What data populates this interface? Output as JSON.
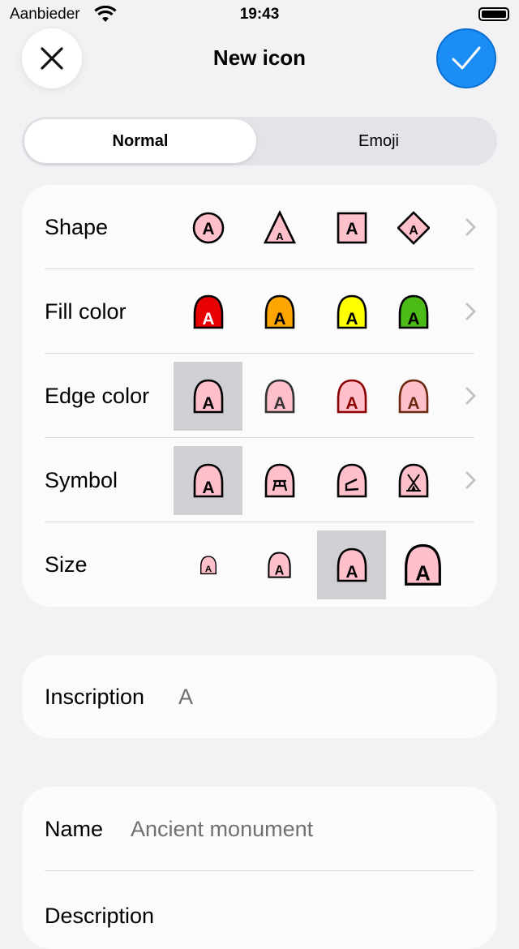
{
  "status_bar": {
    "carrier": "Aanbieder",
    "time": "19:43"
  },
  "header": {
    "title": "New icon"
  },
  "segmented": {
    "options": [
      "Normal",
      "Emoji"
    ],
    "selected": "Normal"
  },
  "options_card": {
    "rows": [
      {
        "label": "Shape",
        "chevron": true,
        "items": [
          {
            "shape": "circle",
            "fill": "#ffc0cb",
            "edge": "#000000",
            "symbol": "A",
            "scale": 1
          },
          {
            "shape": "triangle",
            "fill": "#ffc0cb",
            "edge": "#000000",
            "symbol": "A",
            "scale": 1
          },
          {
            "shape": "square",
            "fill": "#ffc0cb",
            "edge": "#000000",
            "symbol": "A",
            "scale": 1
          },
          {
            "shape": "diamond",
            "fill": "#ffc0cb",
            "edge": "#000000",
            "symbol": "A",
            "scale": 1
          }
        ]
      },
      {
        "label": "Fill color",
        "chevron": true,
        "items": [
          {
            "shape": "arch",
            "fill": "#e60000",
            "edge": "#000000",
            "symbol": "A",
            "text": "#ffffff",
            "scale": 1
          },
          {
            "shape": "arch",
            "fill": "#ffa500",
            "edge": "#000000",
            "symbol": "A",
            "scale": 1
          },
          {
            "shape": "arch",
            "fill": "#ffff00",
            "edge": "#000000",
            "symbol": "A",
            "scale": 1
          },
          {
            "shape": "arch",
            "fill": "#4cbb17",
            "edge": "#000000",
            "symbol": "A",
            "scale": 1
          }
        ]
      },
      {
        "label": "Edge color",
        "chevron": true,
        "selected": 0,
        "items": [
          {
            "shape": "arch",
            "fill": "#ffc0cb",
            "edge": "#000000",
            "symbol": "A",
            "scale": 1
          },
          {
            "shape": "arch",
            "fill": "#ffc0cb",
            "edge": "#333333",
            "symbol": "A",
            "text": "#333333",
            "scale": 1
          },
          {
            "shape": "arch",
            "fill": "#ffc0cb",
            "edge": "#8b0000",
            "symbol": "A",
            "text": "#8b0000",
            "scale": 1
          },
          {
            "shape": "arch",
            "fill": "#ffc0cb",
            "edge": "#6b2a10",
            "symbol": "A",
            "text": "#6b2a10",
            "scale": 1
          }
        ]
      },
      {
        "label": "Symbol",
        "chevron": true,
        "selected": 0,
        "items": [
          {
            "shape": "arch",
            "fill": "#ffc0cb",
            "edge": "#000000",
            "symbol": "A",
            "scale": 1
          },
          {
            "shape": "arch",
            "fill": "#ffc0cb",
            "edge": "#000000",
            "symbol": "picnic-table",
            "scale": 1
          },
          {
            "shape": "arch",
            "fill": "#ffc0cb",
            "edge": "#000000",
            "symbol": "ramp",
            "scale": 1
          },
          {
            "shape": "arch",
            "fill": "#ffc0cb",
            "edge": "#000000",
            "symbol": "tent",
            "scale": 1
          }
        ]
      },
      {
        "label": "Size",
        "chevron": false,
        "selected": 2,
        "items": [
          {
            "shape": "arch",
            "fill": "#ffc0cb",
            "edge": "#000000",
            "symbol": "A",
            "scale": 0.55
          },
          {
            "shape": "arch",
            "fill": "#ffc0cb",
            "edge": "#000000",
            "symbol": "A",
            "scale": 0.78
          },
          {
            "shape": "arch",
            "fill": "#ffc0cb",
            "edge": "#000000",
            "symbol": "A",
            "scale": 1
          },
          {
            "shape": "arch",
            "fill": "#ffc0cb",
            "edge": "#000000",
            "symbol": "A",
            "scale": 1.22
          }
        ]
      }
    ]
  },
  "inscription": {
    "label": "Inscription",
    "value": "A"
  },
  "details": {
    "name_label": "Name",
    "name_value": "Ancient monument",
    "description_label": "Description"
  },
  "colors": {
    "accent": "#1a8ef5"
  }
}
